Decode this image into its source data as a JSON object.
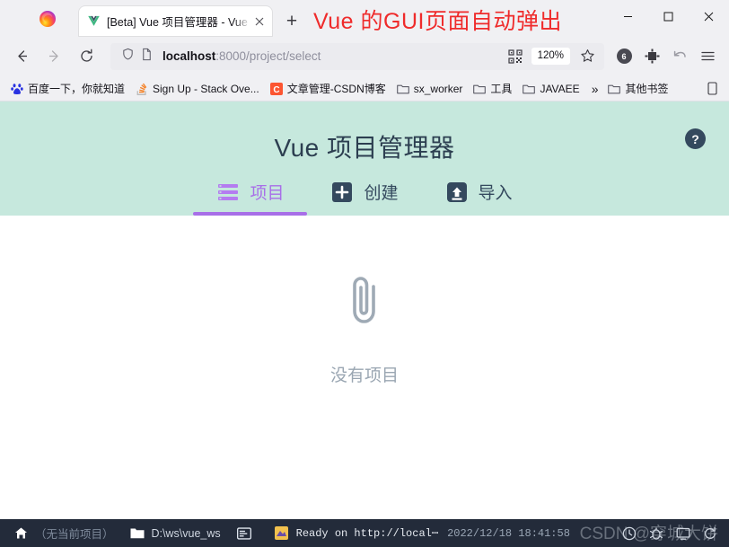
{
  "browser": {
    "tab": {
      "title": "[Beta] Vue 项目管理器 - Vue C",
      "favicon": "vue-logo-icon",
      "close_icon": "close-icon"
    },
    "new_tab_label": "+",
    "annotation": "Vue 的GUI页面自动弹出",
    "window_controls": {
      "minimize": "minimize-icon",
      "maximize": "maximize-icon",
      "close": "close-icon"
    },
    "nav": {
      "back": "back-arrow-icon",
      "forward": "forward-arrow-icon",
      "reload": "reload-icon"
    },
    "urlbar": {
      "shield_icon": "shield-icon",
      "page_icon": "page-icon",
      "host": "localhost",
      "path": ":8000/project/select",
      "full_url": "localhost:8000/project/select",
      "qr_icon": "qr-code-icon",
      "zoom_level": "120%",
      "bookmark_icon": "star-icon"
    },
    "toolbar": {
      "extension_badge": "6",
      "screenshot_icon": "crop-icon",
      "history_icon": "undo-arrow-icon",
      "menu_icon": "hamburger-menu-icon"
    },
    "bookmarks": [
      {
        "label": "百度一下，你就知道",
        "icon": "baidu-icon"
      },
      {
        "label": "Sign Up - Stack Ove...",
        "icon": "stackoverflow-icon"
      },
      {
        "label": "文章管理-CSDN博客",
        "icon": "csdn-icon"
      },
      {
        "label": "sx_worker",
        "icon": "folder-icon"
      },
      {
        "label": "工具",
        "icon": "folder-icon"
      },
      {
        "label": "JAVAEE",
        "icon": "folder-icon"
      }
    ],
    "bookmarks_overflow": "»",
    "bookmarks_other": {
      "label": "其他书签",
      "icon": "folder-icon"
    },
    "bookmarks_mobile_icon": "mobile-icon"
  },
  "page": {
    "title": "Vue 项目管理器",
    "help_label": "?",
    "header_color": "#c6e8dd",
    "accent_color": "#a86fe8",
    "tabs": [
      {
        "label": "项目",
        "icon": "list-icon",
        "active": true
      },
      {
        "label": "创建",
        "icon": "plus-square-icon",
        "active": false
      },
      {
        "label": "导入",
        "icon": "import-icon",
        "active": false
      }
    ],
    "empty_state": {
      "icon": "paperclip-icon",
      "text": "没有项目"
    }
  },
  "statusbar": {
    "home_icon": "home-icon",
    "current_project": "（无当前项目）",
    "folder_icon": "folder-icon",
    "folder_path": "D:\\ws\\vue_ws",
    "terminal_icon": "terminal-icon",
    "task_icon": "task-icon",
    "task_message": "Ready on http://local⋯",
    "timestamp": "2022/12/18  18:41:58",
    "right_icons": [
      "clock-icon",
      "bug-icon",
      "monitor-icon",
      "refresh-icon"
    ],
    "watermark": "CSDN @穿城大饼"
  }
}
